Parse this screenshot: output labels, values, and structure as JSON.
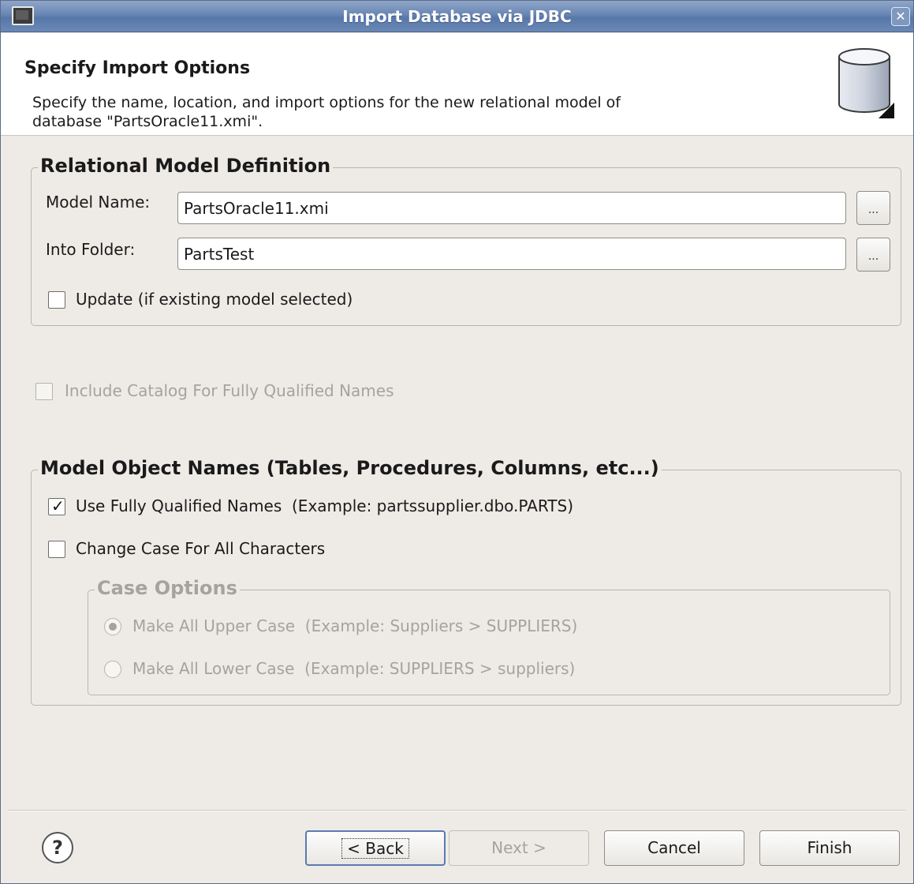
{
  "window": {
    "title": "Import Database via JDBC",
    "close_glyph": "✕"
  },
  "banner": {
    "heading": "Specify Import Options",
    "description_line1": "Specify the name, location, and import options for the new relational model of",
    "description_line2": "database \"PartsOracle11.xmi\".",
    "icon": "database-cylinder-icon"
  },
  "relational_model": {
    "legend": "Relational Model Definition",
    "model_name_label": "Model Name:",
    "model_name_value": "PartsOracle11.xmi",
    "into_folder_label": "Into Folder:",
    "into_folder_value": "PartsTest",
    "browse_label": "...",
    "update_label": "Update (if existing model selected)",
    "update_checked": false
  },
  "include_catalog": {
    "label": "Include Catalog For Fully Qualified Names",
    "checked": false,
    "enabled": false
  },
  "model_object_names": {
    "legend": "Model Object Names (Tables, Procedures, Columns, etc...)",
    "use_fq_label": "Use Fully Qualified Names",
    "use_fq_example": "(Example: partssupplier.dbo.PARTS)",
    "use_fq_checked": true,
    "change_case_label": "Change Case For All Characters",
    "change_case_checked": false,
    "case_options": {
      "legend": "Case Options",
      "enabled": false,
      "upper_label": "Make All Upper Case",
      "upper_example": "(Example: Suppliers > SUPPLIERS)",
      "upper_selected": true,
      "lower_label": "Make All Lower Case",
      "lower_example": "(Example: SUPPLIERS > suppliers)",
      "lower_selected": false
    }
  },
  "buttons": {
    "help_glyph": "?",
    "back": "< Back",
    "next": "Next >",
    "cancel": "Cancel",
    "finish": "Finish"
  },
  "colors": {
    "titlebar": "#6886b4",
    "dialog_bg": "#eeebe7",
    "disabled_text": "#a6a39e"
  }
}
